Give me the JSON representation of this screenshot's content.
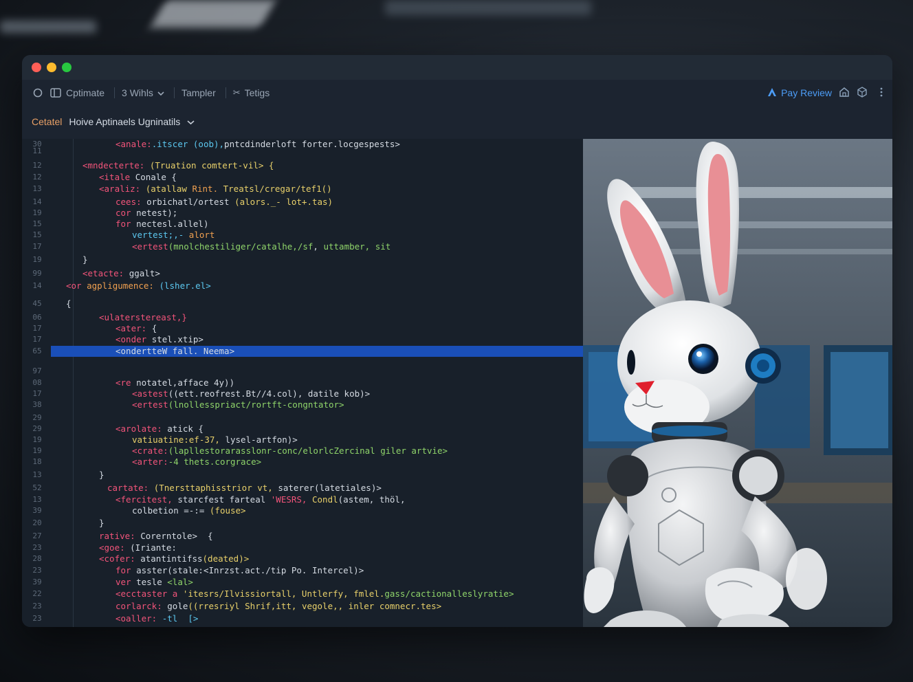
{
  "toolbar": {
    "items": [
      "Cptimate",
      "3 Wihls",
      "Tampler",
      "Tetigs"
    ],
    "pay_review": "Pay Review"
  },
  "breadcrumb": {
    "root": "Cetatel",
    "page": "Hoive Aptinaels Ugninatils"
  },
  "code_lines": [
    {
      "num": "11",
      "indent": 0,
      "parts": []
    },
    {
      "num": "12",
      "indent": 0,
      "parts": [
        [
          "tag",
          "<mndecterte: "
        ],
        [
          "yel",
          "(Truation comtert-vil> {"
        ]
      ]
    },
    {
      "num": "12",
      "indent": 1,
      "parts": [
        [
          "tag",
          "<itale "
        ],
        [
          "txt",
          "Conale {"
        ]
      ]
    },
    {
      "num": "13",
      "indent": 1,
      "parts": [
        [
          "tag",
          "<araliz: "
        ],
        [
          "yel",
          "(atallaw "
        ],
        [
          "key",
          "Rint. "
        ],
        [
          "yel",
          "Treatsl/cregar/tef1()"
        ]
      ]
    },
    {
      "num": "14",
      "indent": 2,
      "parts": [
        [
          "tag",
          "cees: "
        ],
        [
          "txt",
          "orbichatl/ortest "
        ],
        [
          "yel",
          "(alors._- lot+.tas)"
        ]
      ]
    },
    {
      "num": "19",
      "indent": 2,
      "parts": [
        [
          "tag",
          "cor "
        ],
        [
          "txt",
          "netest);"
        ]
      ]
    },
    {
      "num": "15",
      "indent": 2,
      "parts": [
        [
          "tag",
          "for "
        ],
        [
          "txt",
          "nectesl.allel)"
        ]
      ]
    },
    {
      "num": "15",
      "indent": 3,
      "parts": [
        [
          "fn",
          "vertest;,- "
        ],
        [
          "key",
          "alort"
        ]
      ]
    },
    {
      "num": "17",
      "indent": 3,
      "parts": [
        [
          "tag",
          "<ertest"
        ],
        [
          "str",
          "(mnolchestiliger/catalhe,/sf"
        ],
        [
          "txt",
          ", "
        ],
        [
          "str",
          "uttamber, sit"
        ]
      ]
    },
    {
      "num": "19",
      "indent": 0,
      "parts": [
        [
          "txt",
          "}"
        ]
      ]
    },
    {
      "num": "99",
      "indent": 0,
      "parts": [
        [
          "tag",
          "<etacte: "
        ],
        [
          "txt",
          "ggalt>"
        ]
      ]
    },
    {
      "num": "14",
      "indent": -1,
      "parts": [
        [
          "tag",
          "<or "
        ],
        [
          "key",
          "agpligumence: "
        ],
        [
          "fn",
          "(lsher.el>"
        ]
      ]
    },
    {
      "num": "45",
      "indent": -1,
      "parts": [
        [
          "txt",
          "{"
        ]
      ]
    },
    {
      "num": "06",
      "indent": 1,
      "parts": [
        [
          "tag",
          "<ulaterstereast,}"
        ]
      ]
    },
    {
      "num": "17",
      "indent": 2,
      "parts": [
        [
          "tag",
          "<ater: "
        ],
        [
          "txt",
          "{"
        ]
      ]
    },
    {
      "num": "17",
      "indent": 2,
      "parts": [
        [
          "tag",
          "<onder "
        ],
        [
          "txt",
          "stel.xtip>"
        ]
      ]
    },
    {
      "num": "65",
      "indent": 2,
      "parts": [
        [
          "txt",
          "<ondertteW fall. Neema>"
        ]
      ]
    },
    {
      "num": "97",
      "indent": 0,
      "parts": []
    },
    {
      "num": "08",
      "indent": 2,
      "parts": [
        [
          "tag",
          "<re "
        ],
        [
          "txt",
          "notatel,afface 4y))"
        ]
      ]
    },
    {
      "num": "17",
      "indent": 3,
      "parts": [
        [
          "tag",
          "<astest"
        ],
        [
          "txt",
          "((ett.reofrest.Bt//4.col), datile kob)>"
        ]
      ]
    },
    {
      "num": "38",
      "indent": 3,
      "parts": [
        [
          "tag",
          "<ertest"
        ],
        [
          "str",
          "(lnollesspriact/rortft-congntator>"
        ]
      ]
    },
    {
      "num": "29",
      "indent": 0,
      "parts": []
    },
    {
      "num": "29",
      "indent": 2,
      "parts": [
        [
          "tag",
          "<arolate: "
        ],
        [
          "txt",
          "atick {"
        ]
      ]
    },
    {
      "num": "19",
      "indent": 3,
      "parts": [
        [
          "yel",
          "vatiuatine:ef-37, "
        ],
        [
          "txt",
          "lysel-artfon)>"
        ]
      ]
    },
    {
      "num": "19",
      "indent": 3,
      "parts": [
        [
          "tag",
          "<crate:"
        ],
        [
          "str",
          "(lapllestorarasslonr-conc/elorlcZercinal giler artvie>"
        ]
      ]
    },
    {
      "num": "18",
      "indent": 3,
      "parts": [
        [
          "tag",
          "<arter:"
        ],
        [
          "str",
          "-4 thets.corgrace>"
        ]
      ]
    },
    {
      "num": "13",
      "indent": 1,
      "parts": [
        [
          "txt",
          "}"
        ]
      ]
    },
    {
      "num": "52",
      "indent": 1.5,
      "parts": [
        [
          "tag",
          "cartate: "
        ],
        [
          "yel",
          "(Tnersttaphisstrior vt, "
        ],
        [
          "txt",
          "saterer(latetiales)>"
        ]
      ]
    },
    {
      "num": "13",
      "indent": 2,
      "parts": [
        [
          "tag",
          "<fercitest, "
        ],
        [
          "txt",
          "starcfest farteal "
        ],
        [
          "tag",
          "'WESRS, "
        ],
        [
          "yel",
          "Condl"
        ],
        [
          "txt",
          "(astem, thöl,"
        ]
      ]
    },
    {
      "num": "39",
      "indent": 3,
      "parts": [
        [
          "txt",
          "colbetion =-:= "
        ],
        [
          "yel",
          "(fouse>"
        ]
      ]
    },
    {
      "num": "20",
      "indent": 1,
      "parts": [
        [
          "txt",
          "}"
        ]
      ]
    },
    {
      "num": "27",
      "indent": 1,
      "parts": [
        [
          "tag",
          "rative: "
        ],
        [
          "txt",
          "Corerntole>  {"
        ]
      ]
    },
    {
      "num": "23",
      "indent": 1,
      "parts": [
        [
          "tag",
          "<goe: "
        ],
        [
          "txt",
          "(Iriante:"
        ]
      ]
    },
    {
      "num": "28",
      "indent": 1,
      "parts": [
        [
          "tag",
          "<cofer: "
        ],
        [
          "txt",
          "atantintifss"
        ],
        [
          "yel",
          "(deated)>"
        ]
      ]
    },
    {
      "num": "23",
      "indent": 2,
      "parts": [
        [
          "tag",
          "for "
        ],
        [
          "txt",
          "asster(stale:<Inrzst.act./tip Po. Intercel)>"
        ]
      ]
    },
    {
      "num": "39",
      "indent": 2,
      "parts": [
        [
          "tag",
          "ver "
        ],
        [
          "txt",
          "tesle "
        ],
        [
          "str",
          "<lal>"
        ]
      ]
    },
    {
      "num": "22",
      "indent": 2,
      "parts": [
        [
          "tag",
          "<ecctaster a "
        ],
        [
          "yel",
          "'itesrs/Ilvissiortall, Untlerfy, fmlel."
        ],
        [
          "str",
          "gass/cactionalleslyratie>"
        ]
      ]
    },
    {
      "num": "23",
      "indent": 2,
      "parts": [
        [
          "tag",
          "corlarck: "
        ],
        [
          "txt",
          "gole"
        ],
        [
          "yel",
          "((rresriyl Shrif,itt, vegole,, inler comnecr.tes>"
        ]
      ]
    },
    {
      "num": "23",
      "indent": 2,
      "parts": [
        [
          "tag",
          "<oaller: "
        ],
        [
          "fn",
          "-tl  [>"
        ]
      ]
    },
    {
      "num": "30",
      "indent": 2,
      "parts": [
        [
          "tag",
          "<anale:"
        ],
        [
          "fn",
          ".itscer (oob),"
        ],
        [
          "txt",
          "pntcdinderloft forter.locgespests>"
        ]
      ]
    }
  ],
  "highlight_index": 16,
  "colors": {
    "accent": "#4c9cf5",
    "highlight": "#1a4fb8",
    "close": "#ff5f57",
    "minimize": "#febc2e",
    "maximize": "#28c840"
  }
}
